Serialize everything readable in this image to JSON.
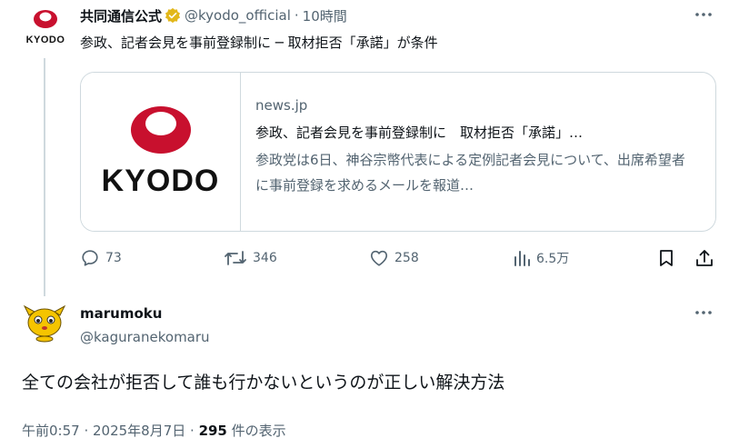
{
  "tweet": {
    "avatar_label": "KYODO",
    "display_name": "共同通信公式",
    "handle": "@kyodo_official",
    "separator": "·",
    "time": "10時間",
    "text": "参政、記者会見を事前登録制に ─ 取材拒否「承諾」が条件",
    "card": {
      "logo_text": "KYODO",
      "domain": "news.jp",
      "title": "参政、記者会見を事前登録制に　取材拒否「承諾」…",
      "description": "参政党は6日、神谷宗幣代表による定例記者会見について、出席希望者に事前登録を求めるメールを報道…"
    },
    "actions": {
      "replies": "73",
      "reposts": "346",
      "likes": "258",
      "views": "6.5万"
    }
  },
  "reply": {
    "display_name": "marumoku",
    "handle": "@kaguranekomaru",
    "text": "全ての会社が拒否して誰も行かないというのが正しい解決方法",
    "time": "午前0:57 · 2025年8月7日 · ",
    "views_count": "295",
    "views_label": " 件の表示"
  },
  "icons": {
    "verified": "verified-badge-icon",
    "more": "more-icon",
    "reply": "reply-icon",
    "repost": "repost-icon",
    "like": "like-icon",
    "views": "views-icon",
    "bookmark": "bookmark-icon",
    "share": "share-icon"
  },
  "colors": {
    "brand_red": "#c8102e",
    "verified_gold": "#e2b719",
    "secondary_text": "#536471",
    "border": "#cfd9de"
  }
}
